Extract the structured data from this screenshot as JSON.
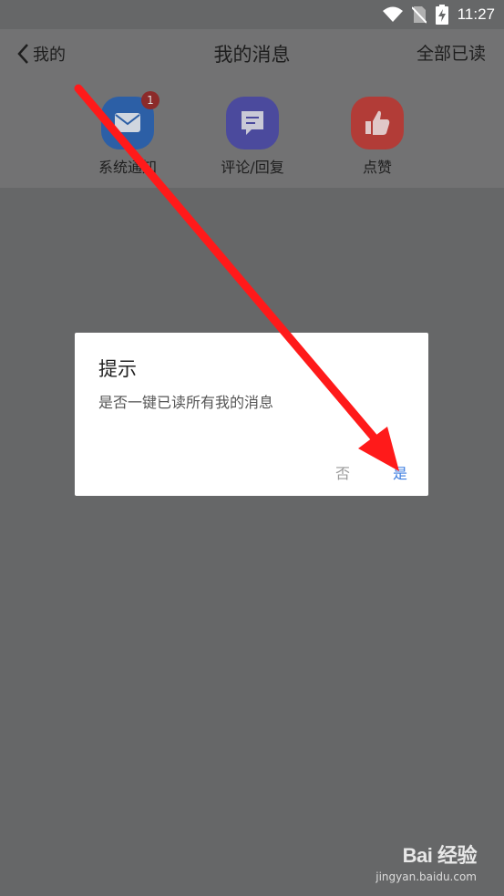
{
  "status": {
    "time": "11:27"
  },
  "header": {
    "back_label": "我的",
    "title": "我的消息",
    "mark_all_read": "全部已读"
  },
  "categories": [
    {
      "label": "系统通知",
      "badge": "1",
      "color": "#2c5fa6"
    },
    {
      "label": "评论/回复",
      "badge": "",
      "color": "#4b4a9d"
    },
    {
      "label": "点赞",
      "badge": "",
      "color": "#b23c37"
    }
  ],
  "dialog": {
    "title": "提示",
    "message": "是否一键已读所有我的消息",
    "cancel": "否",
    "confirm": "是"
  },
  "colors": {
    "overlay": "#666768",
    "accent": "#3f7fe0",
    "arrow": "#ff1a1a"
  },
  "watermark": {
    "logo": "Bai 经验",
    "url": "jingyan.baidu.com"
  }
}
